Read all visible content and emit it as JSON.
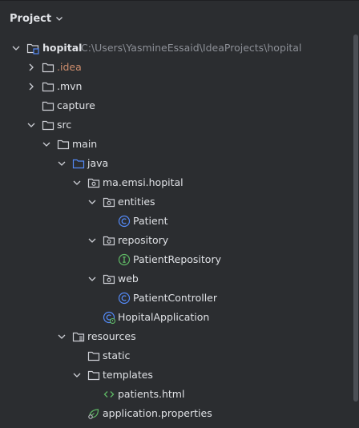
{
  "panel": {
    "title": "Project"
  },
  "tree": {
    "root": {
      "name": "hopital",
      "path": "C:\\Users\\YasmineEssaid\\IdeaProjects\\hopital"
    },
    "idea": {
      "name": ".idea"
    },
    "mvn": {
      "name": ".mvn"
    },
    "capture": {
      "name": "capture"
    },
    "src": {
      "name": "src"
    },
    "main": {
      "name": "main"
    },
    "java": {
      "name": "java"
    },
    "package": {
      "name": "ma.emsi.hopital"
    },
    "entities": {
      "name": "entities"
    },
    "patient": {
      "name": "Patient"
    },
    "repository": {
      "name": "repository"
    },
    "patient_repository": {
      "name": "PatientRepository"
    },
    "web": {
      "name": "web"
    },
    "patient_controller": {
      "name": "PatientController"
    },
    "hopital_application": {
      "name": "HopitalApplication"
    },
    "resources": {
      "name": "resources"
    },
    "static": {
      "name": "static"
    },
    "templates": {
      "name": "templates"
    },
    "patients_html": {
      "name": "patients.html"
    },
    "application_properties": {
      "name": "application.properties"
    }
  },
  "colors": {
    "background": "#2b2d30",
    "text": "#dfe1e5",
    "path_text": "#8c8f96",
    "excluded_text": "#cf8e6d",
    "folder_stroke": "#ced0d6",
    "source_folder": "#548af7",
    "class_icon": "#548af7",
    "interface_icon": "#5fb865",
    "html_icon": "#5fb865",
    "properties_icon": "#5fb865"
  }
}
